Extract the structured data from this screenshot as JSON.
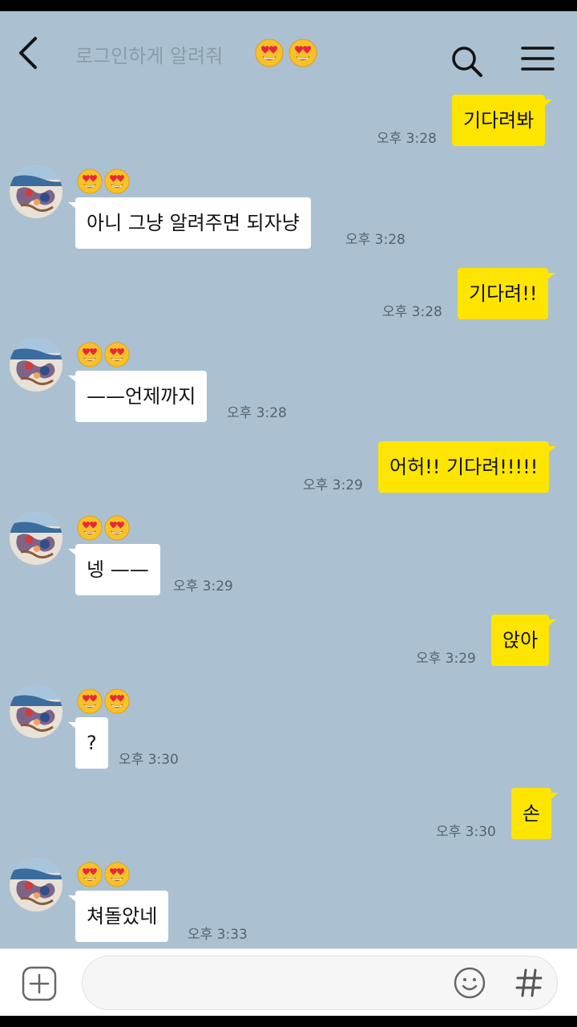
{
  "header": {
    "title": "로그인하게 알려줘",
    "title_emojis": [
      "heart-eyes-emoji",
      "heart-eyes-emoji"
    ]
  },
  "messages": [
    {
      "from": "me",
      "text": "기다려봐",
      "time": "오후 3:28"
    },
    {
      "from": "other",
      "text": "아니 그냥 알려주면 되자냥",
      "time": "오후 3:28"
    },
    {
      "from": "me",
      "text": "기다려!!",
      "time": "오후 3:28"
    },
    {
      "from": "other",
      "text": "——언제까지",
      "time": "오후 3:28"
    },
    {
      "from": "me",
      "text": "어허!! 기다려!!!!!",
      "time": "오후 3:29"
    },
    {
      "from": "other",
      "text": "넹 ——",
      "time": "오후 3:29"
    },
    {
      "from": "me",
      "text": "앉아",
      "time": "오후 3:29"
    },
    {
      "from": "other",
      "text": "?",
      "time": "오후 3:30"
    },
    {
      "from": "me",
      "text": "손",
      "time": "오후 3:30"
    },
    {
      "from": "other",
      "text": "쳐돌았네",
      "time": "오후 3:33"
    }
  ],
  "other_name_emojis": [
    "heart-eyes-emoji",
    "heart-eyes-emoji"
  ],
  "input": {
    "value": ""
  },
  "colors": {
    "background": "#abc1d1",
    "my_bubble": "#fee500",
    "other_bubble": "#ffffff",
    "time_text": "#55626d"
  }
}
